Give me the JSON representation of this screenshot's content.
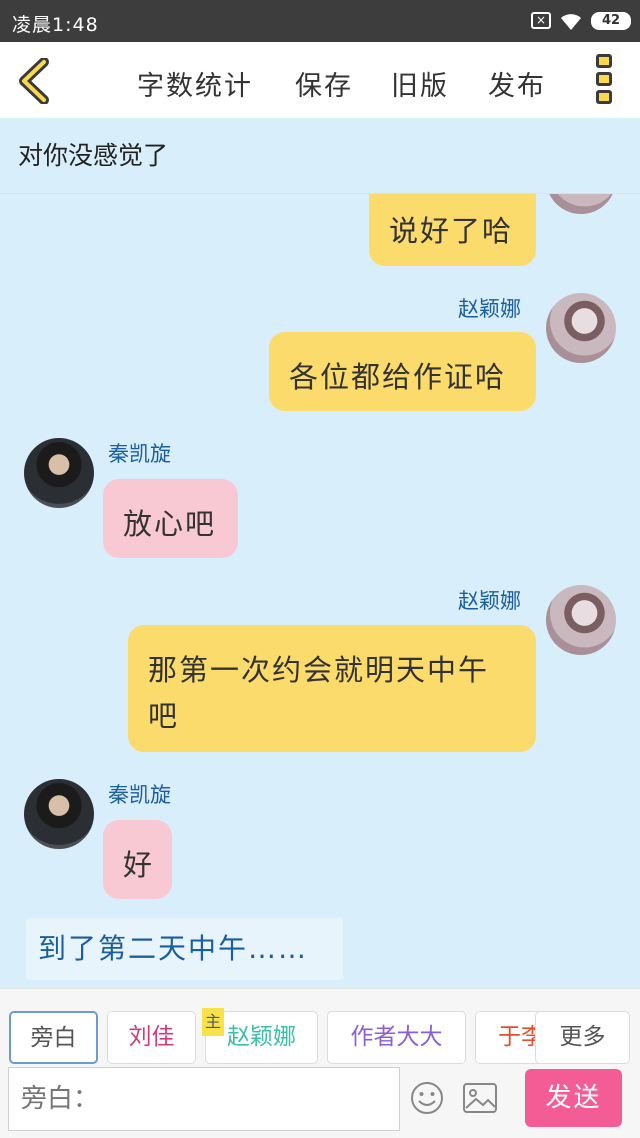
{
  "status_bar": {
    "time": "凌晨1:48",
    "battery": "42"
  },
  "toolbar": {
    "word_count": "字数统计",
    "save": "保存",
    "old_version": "旧版",
    "publish": "发布"
  },
  "story": {
    "title": "对你没感觉了"
  },
  "messages": [
    {
      "text": "说好了哈"
    },
    {
      "name": "赵颖娜",
      "text": "各位都给作证哈"
    },
    {
      "name": "秦凯旋",
      "text": "放心吧"
    },
    {
      "name": "赵颖娜",
      "text": "那第一次约会就明天中午吧"
    },
    {
      "name": "秦凯旋",
      "text": "好"
    }
  ],
  "narration": "到了第二天中午……",
  "roles": [
    {
      "label": "旁白"
    },
    {
      "label": "刘佳"
    },
    {
      "label": "赵颖娜",
      "tag": "主"
    },
    {
      "label": "作者大大"
    },
    {
      "label": "于李"
    },
    {
      "label": "更多"
    }
  ],
  "input": {
    "placeholder": "旁白："
  },
  "send": {
    "label": "发送"
  },
  "colors": {
    "background": "#d9eefb",
    "bubble_yellow": "#fbdb6b",
    "bubble_pink": "#f9c9d3",
    "name_blue": "#1a5e9e",
    "send_pink": "#f45c95",
    "accent_yellow": "#fbd94f"
  }
}
